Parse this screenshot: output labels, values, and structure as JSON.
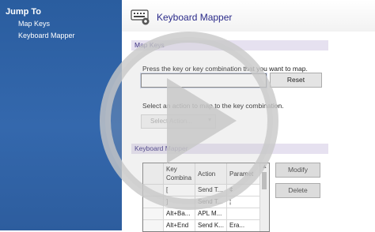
{
  "sidebar": {
    "title": "Jump To",
    "links": [
      "Map Keys",
      "Keyboard Mapper"
    ]
  },
  "header": {
    "title": "Keyboard Mapper",
    "icon": "keyboard-gear-icon"
  },
  "map_keys": {
    "section_label": "Map Keys",
    "prompt": "Press the key or key combination that you want to map.",
    "key_input_value": "",
    "reset_label": "Reset",
    "action_prompt": "Select an action to map to the key combination.",
    "action_select_value": "Select Action..."
  },
  "keyboard_mapper": {
    "section_label": "Keyboard Mapper",
    "columns": [
      "",
      "Key Combina",
      "Action",
      "Paramet"
    ],
    "rows": [
      [
        "",
        "[",
        "Send T...",
        "¢"
      ],
      [
        "",
        "]",
        "Send T...",
        "¦"
      ],
      [
        "",
        "Alt+Ba...",
        "APL M...",
        ""
      ],
      [
        "",
        "Alt+End",
        "Send K...",
        "Era..."
      ]
    ],
    "modify_label": "Modify",
    "delete_label": "Delete"
  },
  "overlay": {
    "icon": "play-icon"
  }
}
